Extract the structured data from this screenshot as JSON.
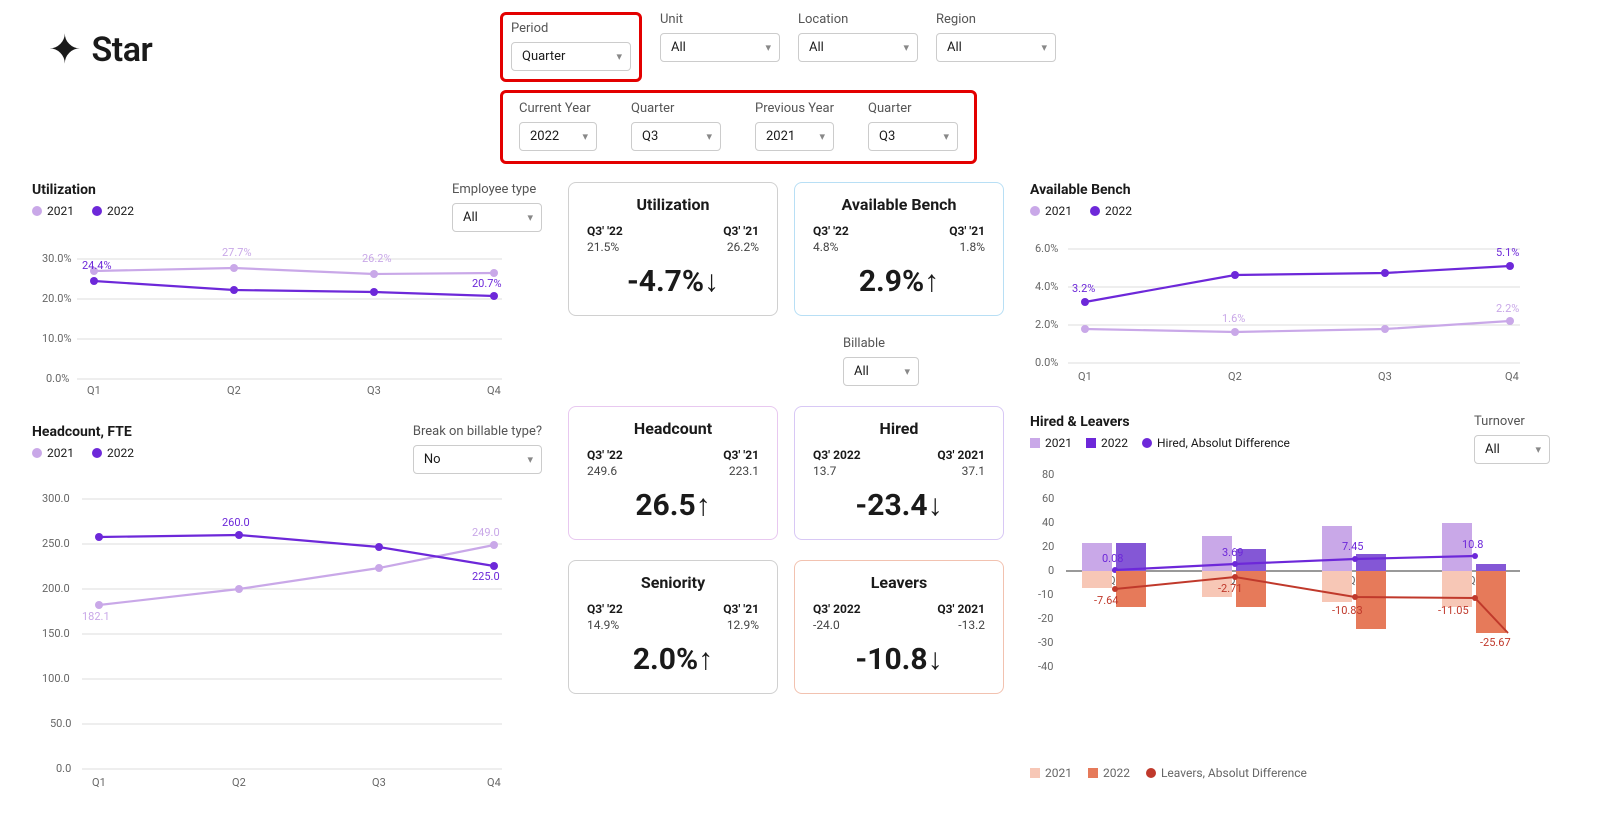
{
  "brand": "Star",
  "filters": {
    "period": {
      "label": "Period",
      "value": "Quarter"
    },
    "unit": {
      "label": "Unit",
      "value": "All"
    },
    "location": {
      "label": "Location",
      "value": "All"
    },
    "region": {
      "label": "Region",
      "value": "All"
    },
    "current_year": {
      "label": "Current Year",
      "value": "2022"
    },
    "current_quarter": {
      "label": "Quarter",
      "value": "Q3"
    },
    "previous_year": {
      "label": "Previous Year",
      "value": "2021"
    },
    "previous_quarter": {
      "label": "Quarter",
      "value": "Q3"
    },
    "employee_type": {
      "label": "Employee type",
      "value": "All"
    },
    "break_billable": {
      "label": "Break on billable type?",
      "value": "No"
    },
    "billable": {
      "label": "Billable",
      "value": "All"
    },
    "turnover": {
      "label": "Turnover",
      "value": "All"
    }
  },
  "legend": {
    "y2021": "2021",
    "y2022": "2022",
    "hired_abs": "Hired, Absolut Difference",
    "leavers_abs": "Leavers, Absolut Difference"
  },
  "kpi": {
    "utilization": {
      "title": "Utilization",
      "cur_label": "Q3' '22",
      "cur_val": "21.5%",
      "prev_label": "Q3' '21",
      "prev_val": "26.2%",
      "delta": "-4.7%↓"
    },
    "bench": {
      "title": "Available Bench",
      "cur_label": "Q3' '22",
      "cur_val": "4.8%",
      "prev_label": "Q3' '21",
      "prev_val": "1.8%",
      "delta": "2.9%↑"
    },
    "headcount": {
      "title": "Headcount",
      "cur_label": "Q3' '22",
      "cur_val": "249.6",
      "prev_label": "Q3' '21",
      "prev_val": "223.1",
      "delta": "26.5↑"
    },
    "hired": {
      "title": "Hired",
      "cur_label": "Q3' 2022",
      "cur_val": "13.7",
      "prev_label": "Q3' 2021",
      "prev_val": "37.1",
      "delta": "-23.4↓"
    },
    "seniority": {
      "title": "Seniority",
      "cur_label": "Q3' '22",
      "cur_val": "14.9%",
      "prev_label": "Q3' '21",
      "prev_val": "12.9%",
      "delta": "2.0%↑"
    },
    "leavers": {
      "title": "Leavers",
      "cur_label": "Q3' 2022",
      "cur_val": "-24.0",
      "prev_label": "Q3' 2021",
      "prev_val": "-13.2",
      "delta": "-10.8↓"
    }
  },
  "titles": {
    "utilization": "Utilization",
    "headcount": "Headcount, FTE",
    "bench": "Available Bench",
    "hired_leavers": "Hired & Leavers"
  },
  "chart_data": [
    {
      "id": "utilization_by_quarter",
      "type": "line",
      "title": "Utilization",
      "xlabel": "",
      "ylabel": "",
      "categories": [
        "Q1",
        "Q2",
        "Q3",
        "Q4"
      ],
      "series": [
        {
          "name": "2021",
          "values": [
            27.0,
            27.7,
            26.2,
            26.5
          ]
        },
        {
          "name": "2022",
          "values": [
            24.4,
            22.3,
            21.8,
            20.7
          ]
        }
      ],
      "ylim": [
        0,
        30
      ],
      "yticks": [
        0,
        10,
        20,
        30
      ],
      "labels": {
        "2021_Q2": "27.7%",
        "2021_Q3": "26.2%",
        "2022_Q1": "24.4%",
        "2022_Q4": "20.7%"
      }
    },
    {
      "id": "headcount_fte",
      "type": "line",
      "title": "Headcount, FTE",
      "categories": [
        "Q1",
        "Q2",
        "Q3",
        "Q4"
      ],
      "series": [
        {
          "name": "2021",
          "values": [
            182.1,
            200.0,
            223.1,
            249.0
          ]
        },
        {
          "name": "2022",
          "values": [
            258.0,
            260.0,
            246.0,
            225.0
          ]
        }
      ],
      "ylim": [
        0,
        300
      ],
      "yticks": [
        0,
        50,
        100,
        150,
        200,
        250,
        300
      ],
      "labels": {
        "2021_Q1": "182.1",
        "2021_Q4": "249.0",
        "2022_Q2": "260.0",
        "2022_Q4": "225.0"
      }
    },
    {
      "id": "available_bench",
      "type": "line",
      "title": "Available Bench",
      "categories": [
        "Q1",
        "Q2",
        "Q3",
        "Q4"
      ],
      "series": [
        {
          "name": "2021",
          "values": [
            1.8,
            1.6,
            1.8,
            2.2
          ]
        },
        {
          "name": "2022",
          "values": [
            3.2,
            4.6,
            4.7,
            5.1
          ]
        }
      ],
      "ylim": [
        0,
        6
      ],
      "yticks": [
        0,
        2,
        4,
        6
      ],
      "labels": {
        "2021_Q2": "1.6%",
        "2021_Q4": "2.2%",
        "2022_Q1": "3.2%",
        "2022_Q4": "5.1%"
      }
    },
    {
      "id": "hired_and_leavers",
      "type": "bar",
      "title": "Hired & Leavers",
      "categories": [
        "Q1",
        "Q2",
        "Q3",
        "Q4"
      ],
      "series": [
        {
          "name": "Hired 2021",
          "values": [
            23,
            29,
            37,
            40
          ]
        },
        {
          "name": "Hired 2022",
          "values": [
            23,
            18,
            14,
            6
          ]
        },
        {
          "name": "Hired, Absolut Difference",
          "values": [
            0.08,
            3.69,
            7.45,
            10.8
          ],
          "type": "line"
        },
        {
          "name": "Leavers 2021",
          "values": [
            -7,
            -11,
            -13,
            -15
          ]
        },
        {
          "name": "Leavers 2022",
          "values": [
            -15,
            -15,
            -24,
            -26
          ]
        },
        {
          "name": "Leavers, Absolut Difference",
          "values": [
            -7.64,
            -2.71,
            -10.83,
            -11.05
          ],
          "type": "line",
          "endpoint": -25.67
        }
      ],
      "ylim": [
        -40,
        80
      ],
      "yticks": [
        -40,
        -30,
        -20,
        -10,
        0,
        10,
        20,
        40,
        60,
        80
      ],
      "labels": {
        "hired_Q1": "0.08",
        "hired_Q2": "3.69",
        "hired_Q3": "7.45",
        "hired_Q4": "10.8",
        "leav_Q1": "-7.64",
        "leav_Q2": "-2.71",
        "leav_Q3": "-10.83",
        "leav_Q4": "-11.05",
        "leav_end": "-25.67"
      }
    }
  ]
}
